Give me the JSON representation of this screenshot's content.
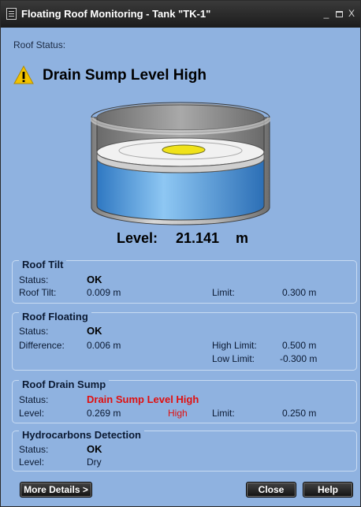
{
  "window": {
    "title": "Floating Roof Monitoring - Tank \"TK-1\"",
    "minimize_glyph": "_",
    "close_glyph": "X"
  },
  "roof_status": {
    "label": "Roof Status:",
    "alarm_icon": "warning-triangle-icon",
    "alarm_text": "Drain Sump Level High"
  },
  "level": {
    "label": "Level:",
    "value": "21.141",
    "unit": "m"
  },
  "roof_tilt": {
    "title": "Roof Tilt",
    "status_label": "Status:",
    "status_value": "OK",
    "tilt_label": "Roof Tilt:",
    "tilt_value": "0.009 m",
    "limit_label": "Limit:",
    "limit_value": "0.300 m"
  },
  "roof_floating": {
    "title": "Roof Floating",
    "status_label": "Status:",
    "status_value": "OK",
    "difference_label": "Difference:",
    "difference_value": "0.006 m",
    "high_limit_label": "High Limit:",
    "high_limit_value": "0.500 m",
    "low_limit_label": "Low Limit:",
    "low_limit_value": "-0.300 m"
  },
  "roof_drain_sump": {
    "title": "Roof Drain Sump",
    "status_label": "Status:",
    "status_value": "Drain Sump Level High",
    "level_label": "Level:",
    "level_value": "0.269 m",
    "level_state": "High",
    "limit_label": "Limit:",
    "limit_value": "0.250 m"
  },
  "hydrocarbons": {
    "title": "Hydrocarbons Detection",
    "status_label": "Status:",
    "status_value": "OK",
    "level_label": "Level:",
    "level_value": "Dry"
  },
  "buttons": {
    "more_details": "More Details >",
    "close": "Close",
    "help": "Help"
  },
  "colors": {
    "panel_background": "#8fb2e0",
    "alarm_text": "#e01010",
    "warning_icon": "#f2c200",
    "roof_sump": "#f0e21a"
  }
}
